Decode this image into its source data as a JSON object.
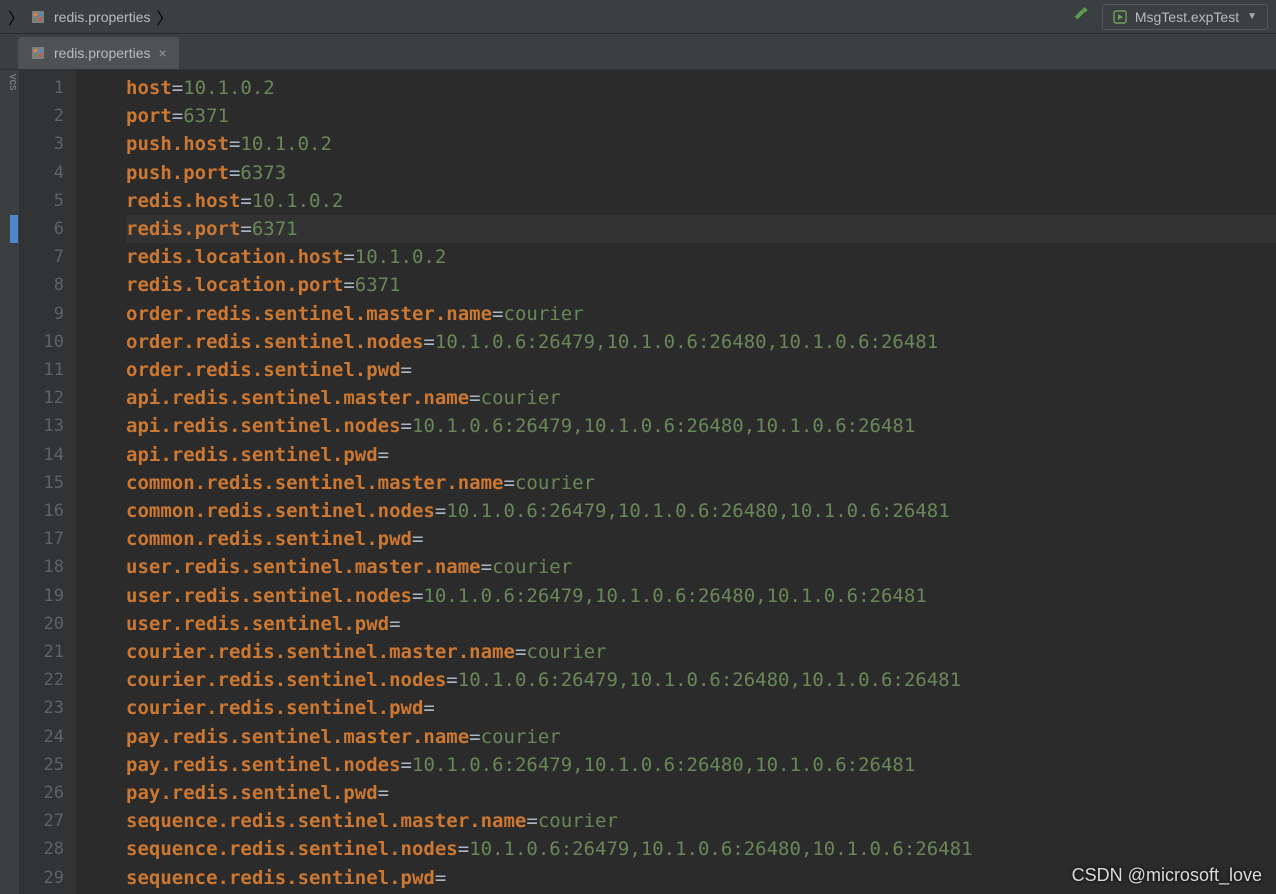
{
  "breadcrumb": {
    "file": "redis.properties"
  },
  "buildTool": {
    "name": "build-icon"
  },
  "runConfig": {
    "label": "MsgTest.expTest"
  },
  "tab": {
    "label": "redis.properties"
  },
  "toolwindow": {
    "left": "vcs"
  },
  "watermark": "CSDN @microsoft_love",
  "currentLine": 6,
  "code": [
    {
      "key": "host",
      "value": "10.1.0.2"
    },
    {
      "key": "port",
      "value": "6371"
    },
    {
      "key": "push.host",
      "value": "10.1.0.2"
    },
    {
      "key": "push.port",
      "value": "6373"
    },
    {
      "key": "redis.host",
      "value": "10.1.0.2"
    },
    {
      "key": "redis.port",
      "value": "6371"
    },
    {
      "key": "redis.location.host",
      "value": "10.1.0.2"
    },
    {
      "key": "redis.location.port",
      "value": "6371"
    },
    {
      "key": "order.redis.sentinel.master.name",
      "value": "courier"
    },
    {
      "key": "order.redis.sentinel.nodes",
      "value": "10.1.0.6:26479,10.1.0.6:26480,10.1.0.6:26481"
    },
    {
      "key": "order.redis.sentinel.pwd",
      "value": ""
    },
    {
      "key": "api.redis.sentinel.master.name",
      "value": "courier"
    },
    {
      "key": "api.redis.sentinel.nodes",
      "value": "10.1.0.6:26479,10.1.0.6:26480,10.1.0.6:26481"
    },
    {
      "key": "api.redis.sentinel.pwd",
      "value": ""
    },
    {
      "key": "common.redis.sentinel.master.name",
      "value": "courier"
    },
    {
      "key": "common.redis.sentinel.nodes",
      "value": "10.1.0.6:26479,10.1.0.6:26480,10.1.0.6:26481"
    },
    {
      "key": "common.redis.sentinel.pwd",
      "value": ""
    },
    {
      "key": "user.redis.sentinel.master.name",
      "value": "courier"
    },
    {
      "key": "user.redis.sentinel.nodes",
      "value": "10.1.0.6:26479,10.1.0.6:26480,10.1.0.6:26481"
    },
    {
      "key": "user.redis.sentinel.pwd",
      "value": ""
    },
    {
      "key": "courier.redis.sentinel.master.name",
      "value": "courier"
    },
    {
      "key": "courier.redis.sentinel.nodes",
      "value": "10.1.0.6:26479,10.1.0.6:26480,10.1.0.6:26481"
    },
    {
      "key": "courier.redis.sentinel.pwd",
      "value": ""
    },
    {
      "key": "pay.redis.sentinel.master.name",
      "value": "courier"
    },
    {
      "key": "pay.redis.sentinel.nodes",
      "value": "10.1.0.6:26479,10.1.0.6:26480,10.1.0.6:26481"
    },
    {
      "key": "pay.redis.sentinel.pwd",
      "value": ""
    },
    {
      "key": "sequence.redis.sentinel.master.name",
      "value": "courier"
    },
    {
      "key": "sequence.redis.sentinel.nodes",
      "value": "10.1.0.6:26479,10.1.0.6:26480,10.1.0.6:26481"
    },
    {
      "key": "sequence.redis.sentinel.pwd",
      "value": ""
    }
  ]
}
